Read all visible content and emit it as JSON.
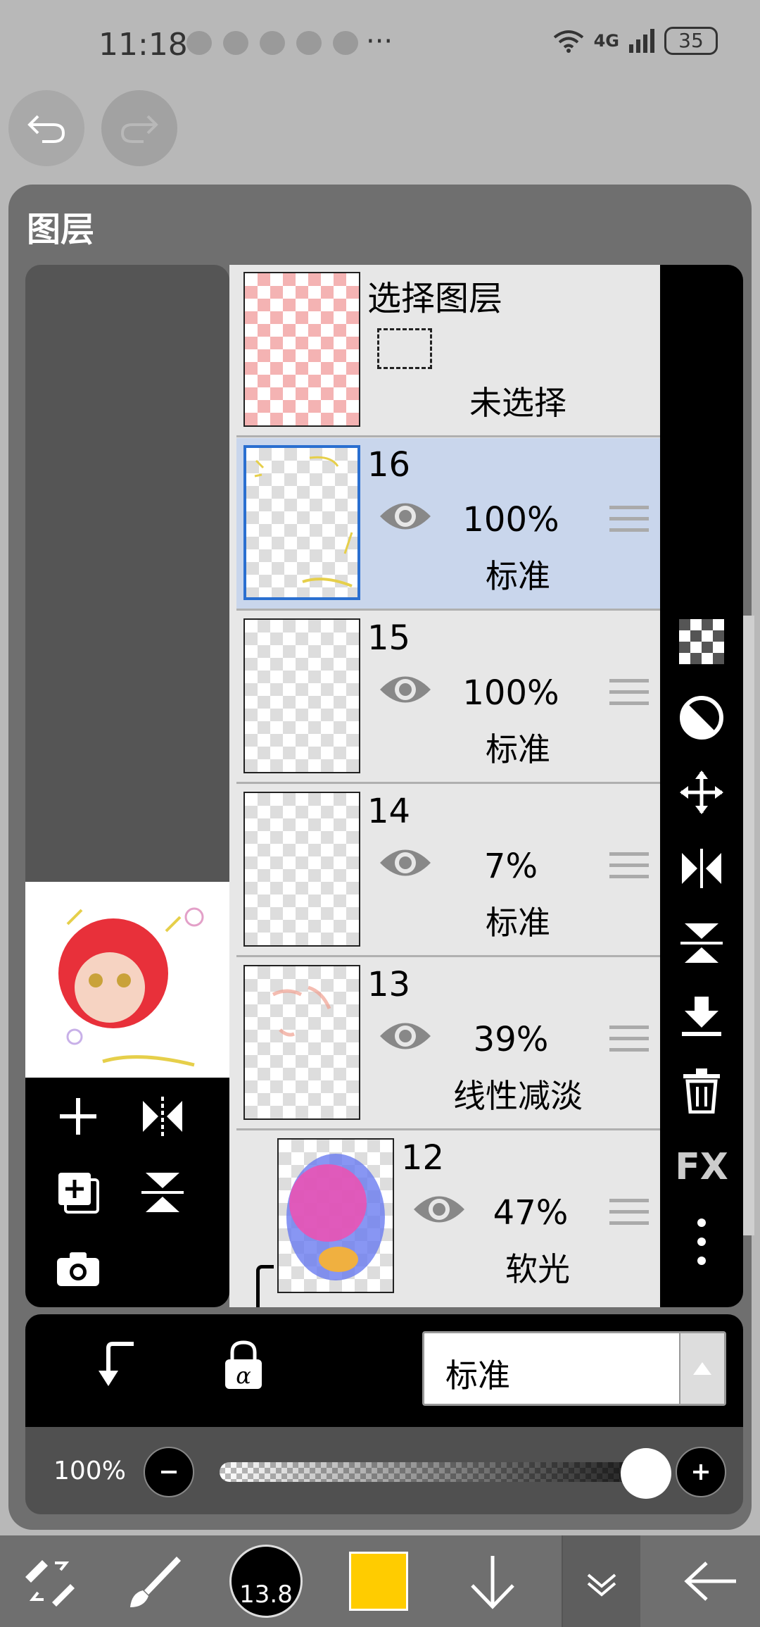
{
  "status": {
    "time": "11:18",
    "more": "···",
    "network": "4G",
    "battery": "35"
  },
  "panel": {
    "title": "图层"
  },
  "selection_layer": {
    "title": "选择图层",
    "status": "未选择"
  },
  "layers": [
    {
      "number": "16",
      "opacity": "100%",
      "blend": "标准",
      "selected": true
    },
    {
      "number": "15",
      "opacity": "100%",
      "blend": "标准",
      "selected": false
    },
    {
      "number": "14",
      "opacity": "7%",
      "blend": "标准",
      "selected": false
    },
    {
      "number": "13",
      "opacity": "39%",
      "blend": "线性减淡",
      "selected": false
    },
    {
      "number": "12",
      "opacity": "47%",
      "blend": "软光",
      "selected": false
    }
  ],
  "right_tools": {
    "fx_label": "FX"
  },
  "bottom_bar": {
    "blend_mode": "标准"
  },
  "opacity_bar": {
    "value": "100%",
    "fraction": 1.0
  },
  "toolbar": {
    "brush_size": "13.8",
    "color": "#ffcc00"
  },
  "colors": {
    "accent": "#2a6fd0",
    "selected_row": "#c9d6ec"
  }
}
